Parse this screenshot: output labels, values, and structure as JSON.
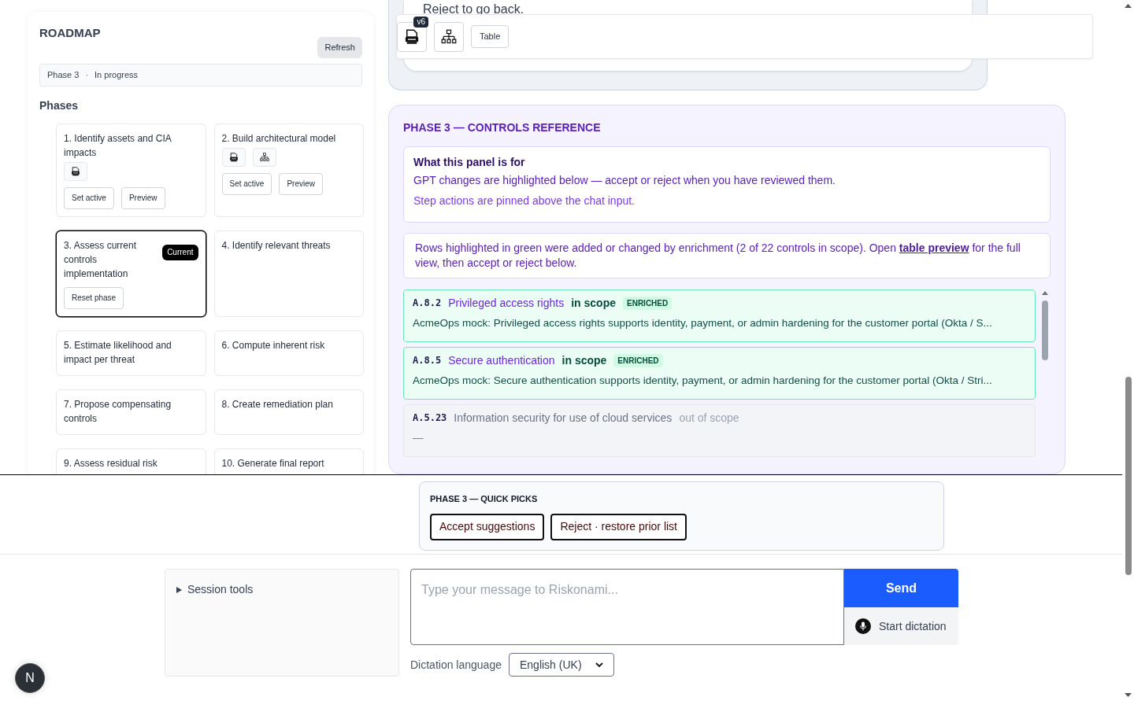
{
  "roadmap": {
    "title": "ROADMAP",
    "refresh": "Refresh",
    "status": {
      "phase": "Phase 3",
      "separator": "·",
      "state": "In progress"
    },
    "phases_heading": "Phases",
    "phases": [
      {
        "title": "1. Identify assets and CIA impacts",
        "current": false,
        "attachments": [
          {
            "kind": "json"
          }
        ],
        "buttons": [
          "Set active",
          "Preview"
        ]
      },
      {
        "title": "2. Build architectural model",
        "current": false,
        "attachments": [
          {
            "kind": "json"
          },
          {
            "kind": "diagram"
          }
        ],
        "buttons": [
          "Set active",
          "Preview"
        ]
      },
      {
        "title": "3. Assess current controls implementation",
        "current": true,
        "badge": "Current",
        "buttons": [
          "Reset phase"
        ]
      },
      {
        "title": "4. Identify relevant threats",
        "current": false
      },
      {
        "title": "5. Estimate likelihood and impact per threat",
        "current": false
      },
      {
        "title": "6. Compute inherent risk",
        "current": false
      },
      {
        "title": "7. Propose compensating controls",
        "current": false
      },
      {
        "title": "8. Create remediation plan",
        "current": false
      },
      {
        "title": "9. Assess residual risk",
        "current": false
      },
      {
        "title": "10. Generate final report",
        "current": false
      }
    ]
  },
  "previous_panel": {
    "text": "Reject to go back."
  },
  "toolbar": {
    "items": [
      {
        "kind": "json",
        "badge": "v6"
      },
      {
        "kind": "diagram"
      },
      {
        "kind": "text",
        "label": "Table"
      }
    ]
  },
  "controls_reference": {
    "title": "PHASE 3 — CONTROLS REFERENCE",
    "info": {
      "heading": "What this panel is for",
      "line": "GPT changes are highlighted below — accept or reject when you have reviewed them.",
      "note": "Step actions are pinned above the chat input."
    },
    "notice": {
      "before": "Rows highlighted in green were added or changed by enrichment (2 of 22 controls in scope). Open ",
      "link": "table preview",
      "after": " for the full view, then accept or reject below."
    },
    "rows": [
      {
        "code": "A.8.2",
        "name": "Privileged access rights",
        "scope": "in scope",
        "in_scope": true,
        "highlighted": true,
        "badge": "ENRICHED",
        "description": "AcmeOps mock: Privileged access rights supports identity, payment, or admin hardening for the customer portal (Okta / S..."
      },
      {
        "code": "A.8.5",
        "name": "Secure authentication",
        "scope": "in scope",
        "in_scope": true,
        "highlighted": true,
        "badge": "ENRICHED",
        "description": "AcmeOps mock: Secure authentication supports identity, payment, or admin hardening for the customer portal (Okta / Stri..."
      },
      {
        "code": "A.5.23",
        "name": "Information security for use of cloud services",
        "scope": "out of scope",
        "in_scope": false,
        "highlighted": false,
        "description": "—"
      }
    ]
  },
  "quick_picks": {
    "title": "PHASE 3 — QUICK PICKS",
    "buttons": [
      "Accept suggestions",
      "Reject · restore prior list"
    ]
  },
  "session_tools": {
    "label": "Session tools",
    "expanded": false
  },
  "chat": {
    "placeholder": "Type your message to Riskonami...",
    "send": "Send",
    "dictation": "Start dictation",
    "language_label": "Dictation language",
    "language": "English (UK)"
  },
  "avatar": {
    "letter": "N"
  }
}
